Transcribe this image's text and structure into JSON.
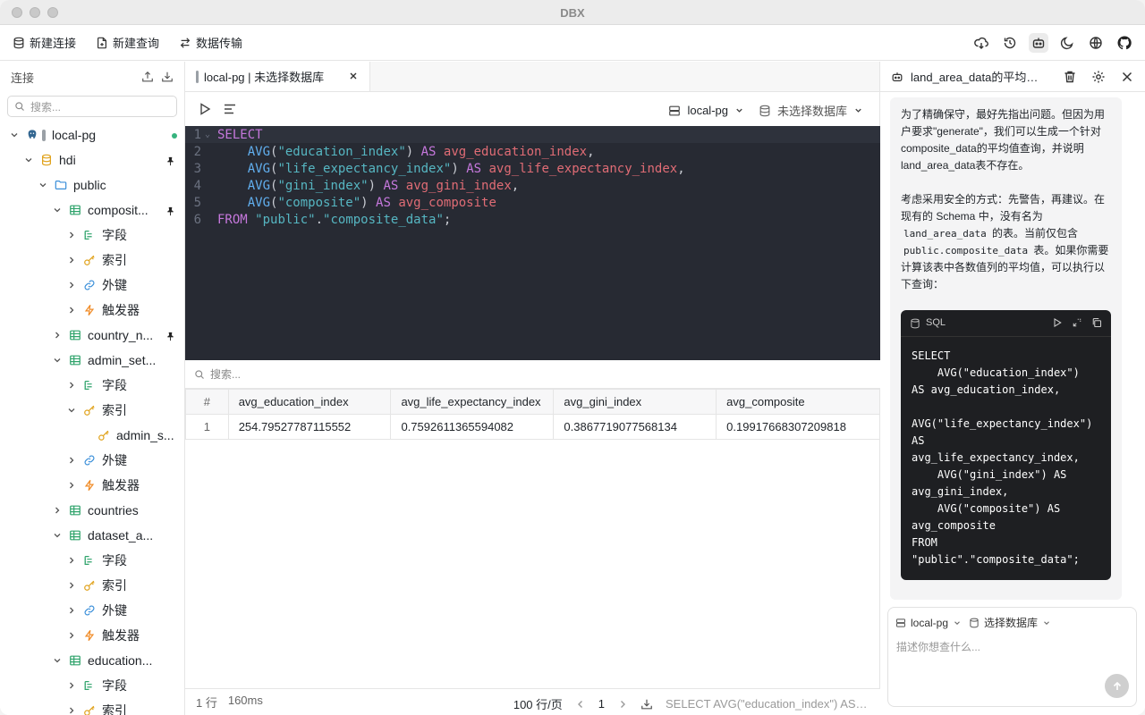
{
  "app": {
    "title": "DBX"
  },
  "toolbar": {
    "new_connection": "新建连接",
    "new_query": "新建查询",
    "data_transfer": "数据传输",
    "right_icons": [
      "download-cloud-icon",
      "history-icon",
      "robot-icon",
      "moon-icon",
      "globe-icon",
      "github-icon"
    ]
  },
  "sidebar": {
    "title": "连接",
    "search_placeholder": "搜索...",
    "tree": [
      {
        "label": "local-pg",
        "depth": 0,
        "icon": "postgres-icon",
        "expanded": true,
        "status": "connected"
      },
      {
        "label": "hdi",
        "depth": 1,
        "icon": "database-icon",
        "expanded": true,
        "pinned": true
      },
      {
        "label": "public",
        "depth": 2,
        "icon": "folder-icon",
        "expanded": true
      },
      {
        "label": "composit...",
        "depth": 3,
        "icon": "table-icon",
        "expanded": true,
        "pinned": true
      },
      {
        "label": "字段",
        "depth": 4,
        "icon": "columns-icon",
        "expanded": false
      },
      {
        "label": "索引",
        "depth": 4,
        "icon": "key-icon",
        "expanded": false
      },
      {
        "label": "外键",
        "depth": 4,
        "icon": "link-icon",
        "expanded": false
      },
      {
        "label": "触发器",
        "depth": 4,
        "icon": "bolt-icon",
        "expanded": false
      },
      {
        "label": "country_n...",
        "depth": 3,
        "icon": "table-icon",
        "expanded": false,
        "pinned": true
      },
      {
        "label": "admin_set...",
        "depth": 3,
        "icon": "table-icon",
        "expanded": true
      },
      {
        "label": "字段",
        "depth": 4,
        "icon": "columns-icon",
        "expanded": false
      },
      {
        "label": "索引",
        "depth": 4,
        "icon": "key-icon",
        "expanded": true
      },
      {
        "label": "admin_s...",
        "depth": 5,
        "icon": "key-icon",
        "leaf": true
      },
      {
        "label": "外键",
        "depth": 4,
        "icon": "link-icon",
        "expanded": false
      },
      {
        "label": "触发器",
        "depth": 4,
        "icon": "bolt-icon",
        "expanded": false
      },
      {
        "label": "countries",
        "depth": 3,
        "icon": "table-icon",
        "expanded": false
      },
      {
        "label": "dataset_a...",
        "depth": 3,
        "icon": "table-icon",
        "expanded": true
      },
      {
        "label": "字段",
        "depth": 4,
        "icon": "columns-icon",
        "expanded": false
      },
      {
        "label": "索引",
        "depth": 4,
        "icon": "key-icon",
        "expanded": false
      },
      {
        "label": "外键",
        "depth": 4,
        "icon": "link-icon",
        "expanded": false
      },
      {
        "label": "触发器",
        "depth": 4,
        "icon": "bolt-icon",
        "expanded": false
      },
      {
        "label": "education...",
        "depth": 3,
        "icon": "table-icon",
        "expanded": true
      },
      {
        "label": "字段",
        "depth": 4,
        "icon": "columns-icon",
        "expanded": false
      },
      {
        "label": "索引",
        "depth": 4,
        "icon": "key-icon",
        "expanded": false
      }
    ]
  },
  "tab": {
    "label": "local-pg | 未选择数据库"
  },
  "query_bar": {
    "connection": "local-pg",
    "database": "未选择数据库"
  },
  "editor": {
    "lines": [
      [
        [
          "kw",
          "SELECT"
        ]
      ],
      [
        [
          "pn",
          "    "
        ],
        [
          "fn",
          "AVG"
        ],
        [
          "pn",
          "("
        ],
        [
          "str",
          "\"education_index\""
        ],
        [
          "pn",
          ") "
        ],
        [
          "kw",
          "AS"
        ],
        [
          "pn",
          " "
        ],
        [
          "id",
          "avg_education_index"
        ],
        [
          "pn",
          ","
        ]
      ],
      [
        [
          "pn",
          "    "
        ],
        [
          "fn",
          "AVG"
        ],
        [
          "pn",
          "("
        ],
        [
          "str",
          "\"life_expectancy_index\""
        ],
        [
          "pn",
          ") "
        ],
        [
          "kw",
          "AS"
        ],
        [
          "pn",
          " "
        ],
        [
          "id",
          "avg_life_expectancy_index"
        ],
        [
          "pn",
          ","
        ]
      ],
      [
        [
          "pn",
          "    "
        ],
        [
          "fn",
          "AVG"
        ],
        [
          "pn",
          "("
        ],
        [
          "str",
          "\"gini_index\""
        ],
        [
          "pn",
          ") "
        ],
        [
          "kw",
          "AS"
        ],
        [
          "pn",
          " "
        ],
        [
          "id",
          "avg_gini_index"
        ],
        [
          "pn",
          ","
        ]
      ],
      [
        [
          "pn",
          "    "
        ],
        [
          "fn",
          "AVG"
        ],
        [
          "pn",
          "("
        ],
        [
          "str",
          "\"composite\""
        ],
        [
          "pn",
          ") "
        ],
        [
          "kw",
          "AS"
        ],
        [
          "pn",
          " "
        ],
        [
          "id",
          "avg_composite"
        ]
      ],
      [
        [
          "kw",
          "FROM"
        ],
        [
          "pn",
          " "
        ],
        [
          "str",
          "\"public\""
        ],
        [
          "pn",
          "."
        ],
        [
          "str",
          "\"composite_data\""
        ],
        [
          "pn",
          ";"
        ]
      ]
    ]
  },
  "results": {
    "search_placeholder": "搜索...",
    "columns": [
      "#",
      "avg_education_index",
      "avg_life_expectancy_index",
      "avg_gini_index",
      "avg_composite"
    ],
    "rows": [
      [
        "1",
        "254.79527787115552",
        "0.7592611365594082",
        "0.3867719077568134",
        "0.19917668307209818"
      ]
    ]
  },
  "status": {
    "rows": "1 行",
    "time": "160ms",
    "page_size": "100 行/页",
    "page": "1",
    "sql_preview": "SELECT AVG(\"education_index\") AS a..."
  },
  "assistant": {
    "title": "land_area_data的平均值...",
    "para1": "为了精确保守，最好先指出问题。但因为用户要求\"generate\"，我们可以生成一个针对composite_data的平均值查询，并说明land_area_data表不存在。",
    "para2_a": "考虑采用安全的方式：先警告，再建议。在现有的 Schema 中，没有名为 ",
    "para2_code1": "land_area_data",
    "para2_b": " 的表。当前仅包含 ",
    "para2_code2": "public.composite_data",
    "para2_c": " 表。如果你需要计算该表中各数值列的平均值，可以执行以下查询：",
    "code_lang": "SQL",
    "code": "SELECT\n    AVG(\"education_index\")\nAS avg_education_index,\n\nAVG(\"life_expectancy_index\")\nAS\navg_life_expectancy_index,\n    AVG(\"gini_index\") AS\navg_gini_index,\n    AVG(\"composite\") AS\navg_composite\nFROM\n\"public\".\"composite_data\";",
    "composer_connection": "local-pg",
    "composer_database": "选择数据库",
    "composer_placeholder": "描述你想查什么..."
  }
}
